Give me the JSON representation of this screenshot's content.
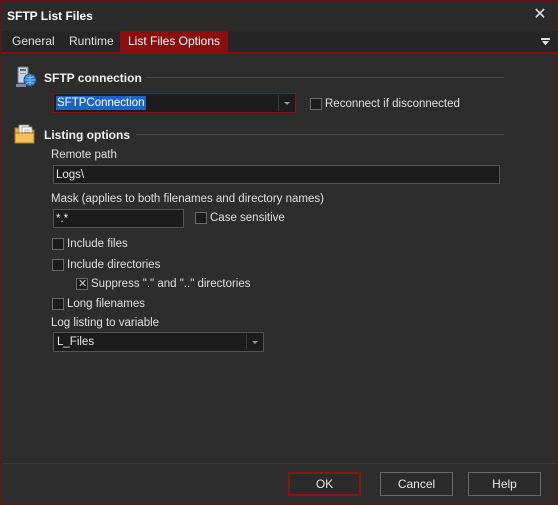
{
  "window": {
    "title": "SFTP List Files",
    "close_glyph": "✕"
  },
  "tabs": [
    {
      "label": "General",
      "active": false
    },
    {
      "label": "Runtime",
      "active": false
    },
    {
      "label": "List Files Options",
      "active": true
    }
  ],
  "sftp_section": {
    "title": "SFTP connection",
    "icon": "network-computer-icon",
    "connection_value": "SFTPConnection",
    "reconnect_label": "Reconnect if disconnected",
    "reconnect_checked": false
  },
  "listing_section": {
    "title": "Listing options",
    "icon": "folder-files-icon",
    "remote_path_label": "Remote path",
    "remote_path_value": "Logs\\",
    "mask_label": "Mask (applies to both filenames and directory names)",
    "mask_value": "*.*",
    "case_sensitive_label": "Case sensitive",
    "case_sensitive_checked": false,
    "include_files_label": "Include files",
    "include_files_checked": false,
    "include_dirs_label": "Include directories",
    "include_dirs_checked": false,
    "suppress_label": "Suppress \".\" and \"..\" directories",
    "suppress_checked": true,
    "suppress_mark": "✕",
    "long_filenames_label": "Long filenames",
    "long_filenames_checked": false,
    "log_var_label": "Log listing to variable",
    "log_var_value": "L_Files"
  },
  "buttons": {
    "ok": "OK",
    "cancel": "Cancel",
    "help": "Help"
  },
  "colors": {
    "accent": "#8a0e0e",
    "selection": "#1e64c8",
    "background": "#2d2d2d"
  }
}
